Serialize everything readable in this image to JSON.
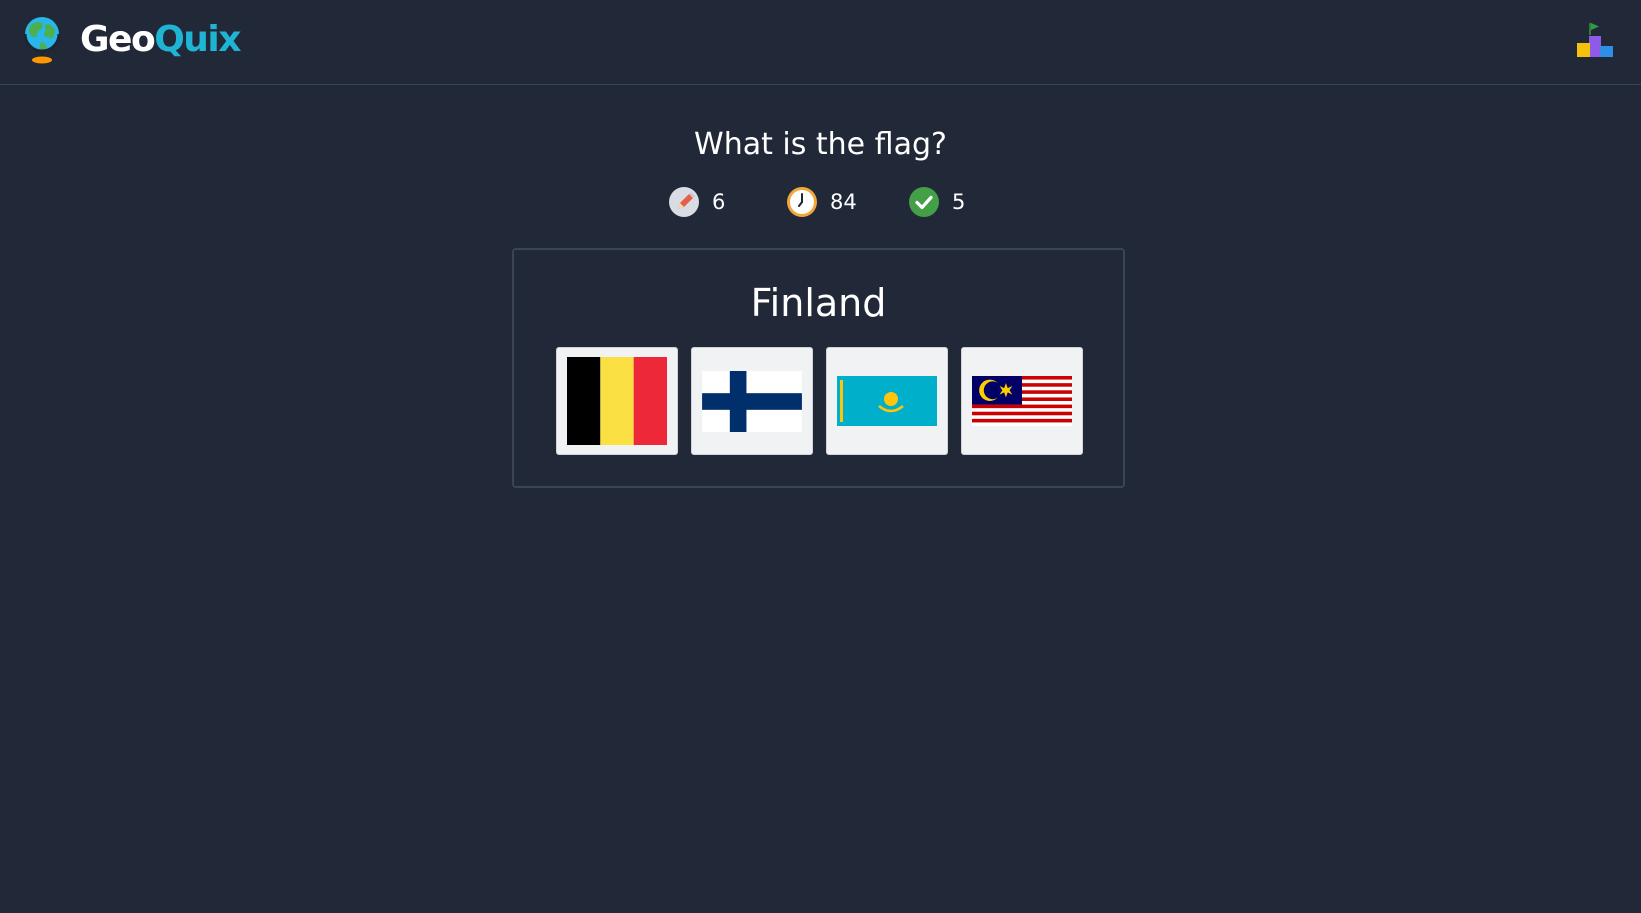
{
  "app": {
    "name_part1": "Geo",
    "name_part2": "Quix",
    "logo_icon": "globe-icon",
    "leaderboard_icon": "podium-icon"
  },
  "quiz": {
    "question": "What is the flag?",
    "stats": [
      {
        "icon": "pencil-icon",
        "value": "6"
      },
      {
        "icon": "clock-icon",
        "value": "84"
      },
      {
        "icon": "check-icon",
        "value": "5"
      }
    ],
    "country": "Finland",
    "options": [
      {
        "flag": "belgium-flag-icon"
      },
      {
        "flag": "finland-flag-icon"
      },
      {
        "flag": "kazakhstan-flag-icon"
      },
      {
        "flag": "malaysia-flag-icon"
      }
    ]
  },
  "colors": {
    "background": "#212939",
    "brand_accent": "#1fb4d4",
    "divider": "#3b4456"
  }
}
